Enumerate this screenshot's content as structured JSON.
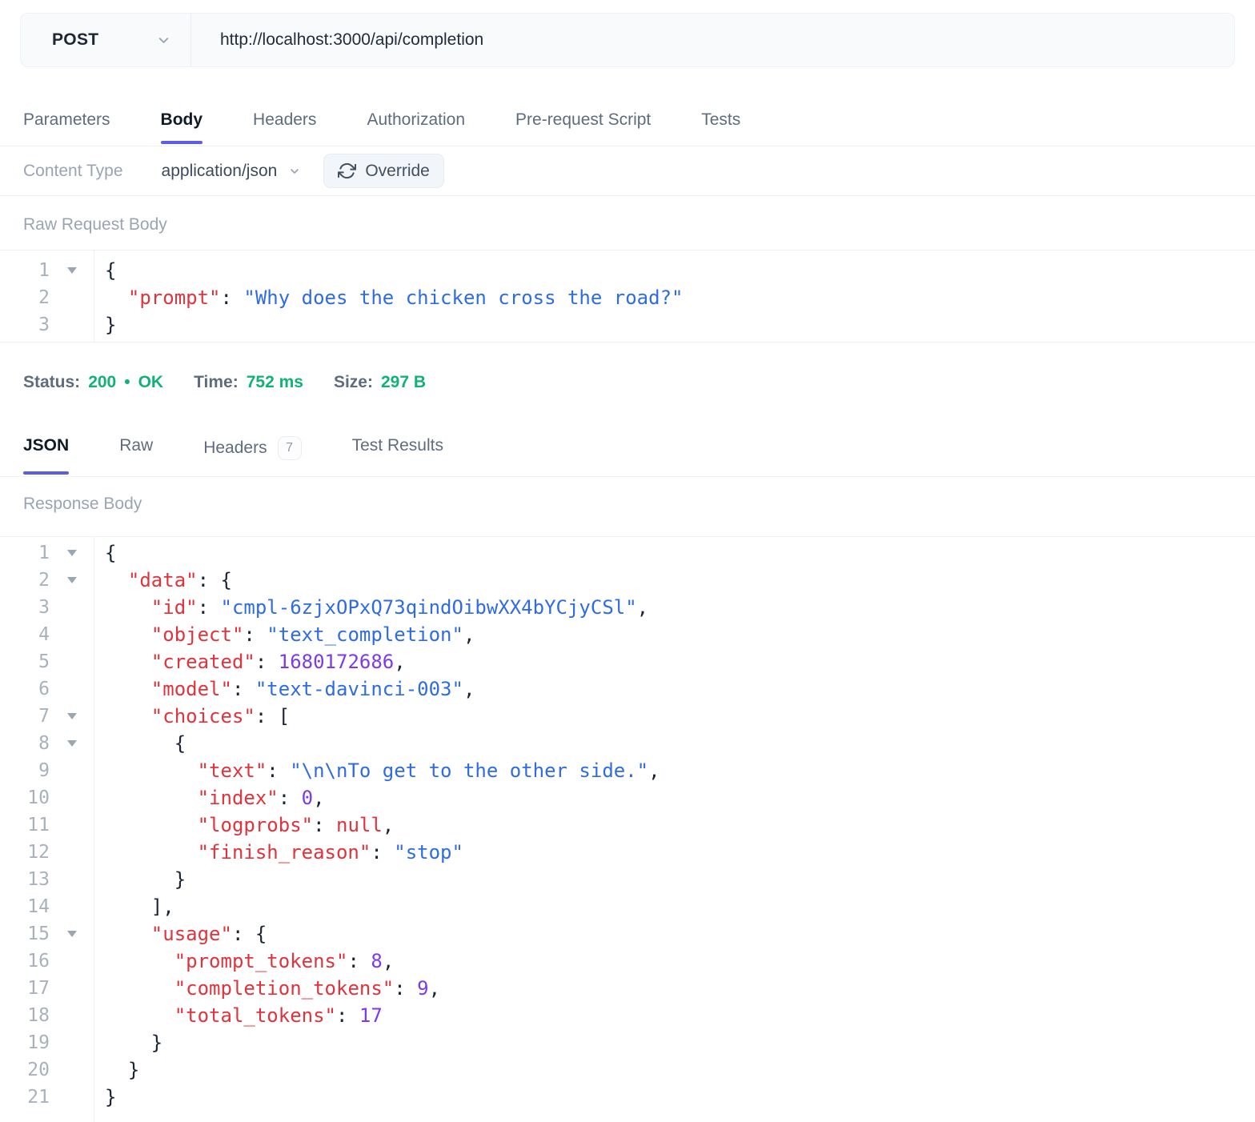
{
  "request": {
    "method": "POST",
    "url": "http://localhost:3000/api/completion",
    "tabs": [
      {
        "label": "Parameters"
      },
      {
        "label": "Body"
      },
      {
        "label": "Headers"
      },
      {
        "label": "Authorization"
      },
      {
        "label": "Pre-request Script"
      },
      {
        "label": "Tests"
      }
    ],
    "content_type": {
      "label": "Content Type",
      "value": "application/json",
      "override_label": "Override"
    },
    "body_section_label": "Raw Request Body",
    "editor_lines": [
      {
        "n": 1,
        "fold": true,
        "tokens": [
          [
            "p",
            "{"
          ]
        ]
      },
      {
        "n": 2,
        "fold": false,
        "tokens": [
          [
            "p",
            "  "
          ],
          [
            "k",
            "\"prompt\""
          ],
          [
            "p",
            ": "
          ],
          [
            "s",
            "\"Why does the chicken cross the road?\""
          ]
        ]
      },
      {
        "n": 3,
        "fold": false,
        "tokens": [
          [
            "p",
            "}"
          ]
        ]
      }
    ]
  },
  "response": {
    "status": {
      "status_label": "Status:",
      "code": "200",
      "dot": "•",
      "reason": "OK",
      "time_label": "Time:",
      "time": "752 ms",
      "size_label": "Size:",
      "size": "297 B"
    },
    "tabs": [
      {
        "label": "JSON"
      },
      {
        "label": "Raw"
      },
      {
        "label": "Headers",
        "badge": "7"
      },
      {
        "label": "Test Results"
      }
    ],
    "body_section_label": "Response Body",
    "editor_lines": [
      {
        "n": 1,
        "fold": true,
        "tokens": [
          [
            "p",
            "{"
          ]
        ]
      },
      {
        "n": 2,
        "fold": true,
        "tokens": [
          [
            "p",
            "  "
          ],
          [
            "k",
            "\"data\""
          ],
          [
            "p",
            ": {"
          ]
        ]
      },
      {
        "n": 3,
        "fold": false,
        "tokens": [
          [
            "p",
            "    "
          ],
          [
            "k",
            "\"id\""
          ],
          [
            "p",
            ": "
          ],
          [
            "s",
            "\"cmpl-6zjxOPxQ73qindOibwXX4bYCjyCSl\""
          ],
          [
            "p",
            ","
          ]
        ]
      },
      {
        "n": 4,
        "fold": false,
        "tokens": [
          [
            "p",
            "    "
          ],
          [
            "k",
            "\"object\""
          ],
          [
            "p",
            ": "
          ],
          [
            "s",
            "\"text_completion\""
          ],
          [
            "p",
            ","
          ]
        ]
      },
      {
        "n": 5,
        "fold": false,
        "tokens": [
          [
            "p",
            "    "
          ],
          [
            "k",
            "\"created\""
          ],
          [
            "p",
            ": "
          ],
          [
            "n",
            "1680172686"
          ],
          [
            "p",
            ","
          ]
        ]
      },
      {
        "n": 6,
        "fold": false,
        "tokens": [
          [
            "p",
            "    "
          ],
          [
            "k",
            "\"model\""
          ],
          [
            "p",
            ": "
          ],
          [
            "s",
            "\"text-davinci-003\""
          ],
          [
            "p",
            ","
          ]
        ]
      },
      {
        "n": 7,
        "fold": true,
        "tokens": [
          [
            "p",
            "    "
          ],
          [
            "k",
            "\"choices\""
          ],
          [
            "p",
            ": ["
          ]
        ]
      },
      {
        "n": 8,
        "fold": true,
        "tokens": [
          [
            "p",
            "      {"
          ]
        ]
      },
      {
        "n": 9,
        "fold": false,
        "tokens": [
          [
            "p",
            "        "
          ],
          [
            "k",
            "\"text\""
          ],
          [
            "p",
            ": "
          ],
          [
            "s",
            "\"\\n\\nTo get to the other side.\""
          ],
          [
            "p",
            ","
          ]
        ]
      },
      {
        "n": 10,
        "fold": false,
        "tokens": [
          [
            "p",
            "        "
          ],
          [
            "k",
            "\"index\""
          ],
          [
            "p",
            ": "
          ],
          [
            "n",
            "0"
          ],
          [
            "p",
            ","
          ]
        ]
      },
      {
        "n": 11,
        "fold": false,
        "tokens": [
          [
            "p",
            "        "
          ],
          [
            "k",
            "\"logprobs\""
          ],
          [
            "p",
            ": "
          ],
          [
            "x",
            "null"
          ],
          [
            "p",
            ","
          ]
        ]
      },
      {
        "n": 12,
        "fold": false,
        "tokens": [
          [
            "p",
            "        "
          ],
          [
            "k",
            "\"finish_reason\""
          ],
          [
            "p",
            ": "
          ],
          [
            "s",
            "\"stop\""
          ]
        ]
      },
      {
        "n": 13,
        "fold": false,
        "tokens": [
          [
            "p",
            "      }"
          ]
        ]
      },
      {
        "n": 14,
        "fold": false,
        "tokens": [
          [
            "p",
            "    ],"
          ]
        ]
      },
      {
        "n": 15,
        "fold": true,
        "tokens": [
          [
            "p",
            "    "
          ],
          [
            "k",
            "\"usage\""
          ],
          [
            "p",
            ": {"
          ]
        ]
      },
      {
        "n": 16,
        "fold": false,
        "tokens": [
          [
            "p",
            "      "
          ],
          [
            "k",
            "\"prompt_tokens\""
          ],
          [
            "p",
            ": "
          ],
          [
            "n",
            "8"
          ],
          [
            "p",
            ","
          ]
        ]
      },
      {
        "n": 17,
        "fold": false,
        "tokens": [
          [
            "p",
            "      "
          ],
          [
            "k",
            "\"completion_tokens\""
          ],
          [
            "p",
            ": "
          ],
          [
            "n",
            "9"
          ],
          [
            "p",
            ","
          ]
        ]
      },
      {
        "n": 18,
        "fold": false,
        "tokens": [
          [
            "p",
            "      "
          ],
          [
            "k",
            "\"total_tokens\""
          ],
          [
            "p",
            ": "
          ],
          [
            "n",
            "17"
          ]
        ]
      },
      {
        "n": 19,
        "fold": false,
        "tokens": [
          [
            "p",
            "    }"
          ]
        ]
      },
      {
        "n": 20,
        "fold": false,
        "tokens": [
          [
            "p",
            "  }"
          ]
        ]
      },
      {
        "n": 21,
        "fold": false,
        "tokens": [
          [
            "p",
            "}"
          ]
        ]
      }
    ]
  },
  "colors": {
    "accent_indigo": "#5e5ce6",
    "status_green": "#12b277",
    "syntax_key_red": "#e0333c",
    "syntax_string_blue": "#2e6be5",
    "syntax_number_purple": "#7c3aed",
    "syntax_punct_dark": "#1b2434",
    "muted_label": "#9aa4b2",
    "bar_background": "#f8fafc"
  }
}
